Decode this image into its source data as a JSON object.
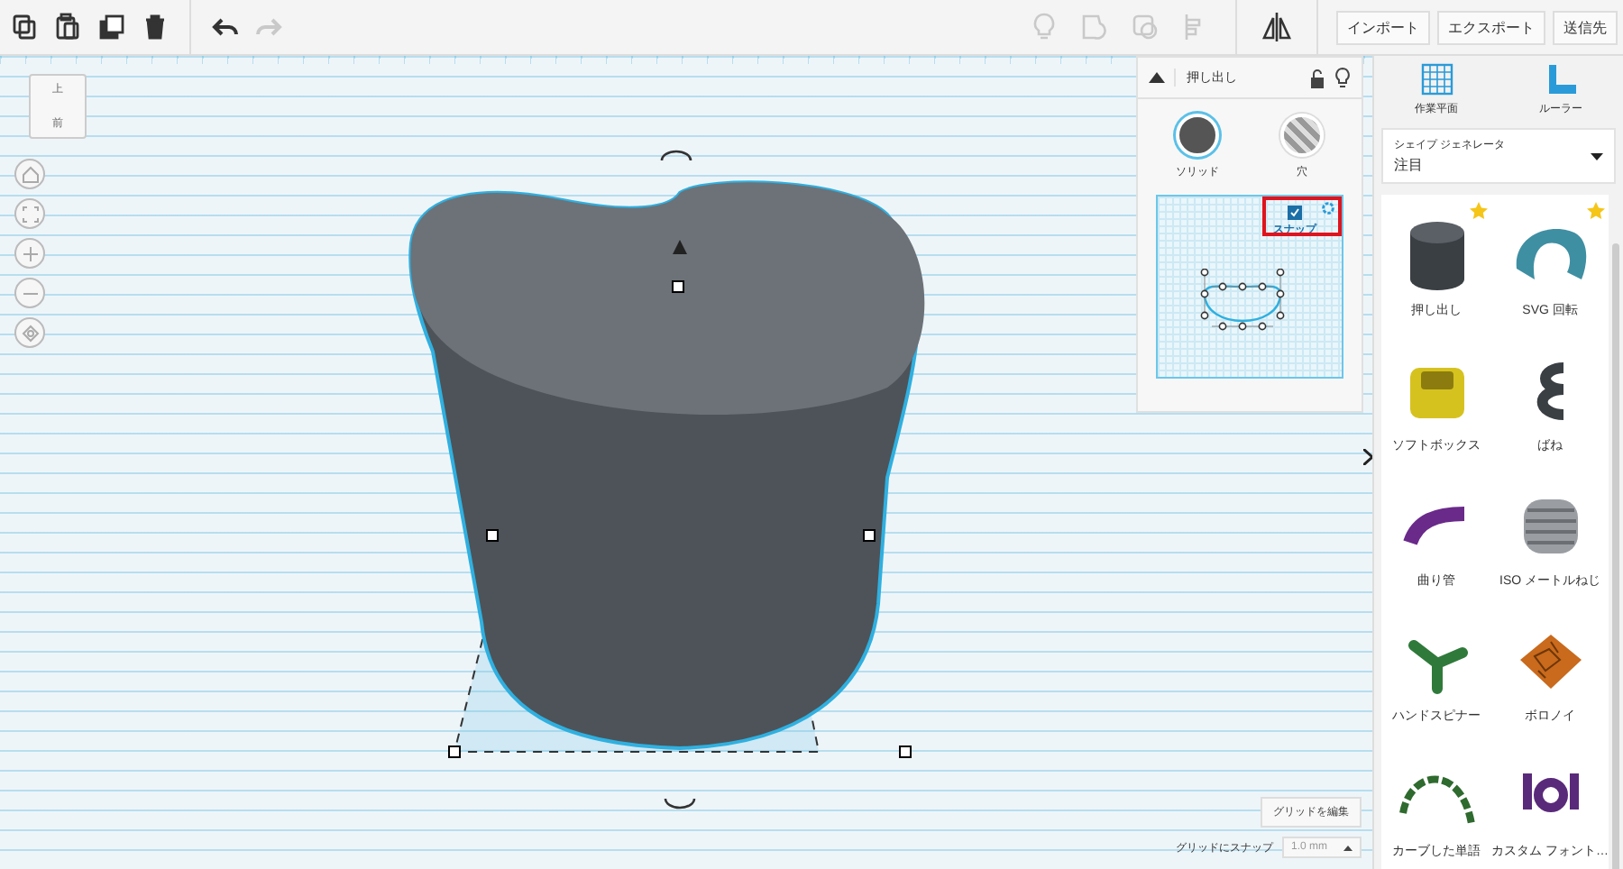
{
  "toolbar": {
    "actions": [
      {
        "kind": "copy",
        "disabled": false
      },
      {
        "kind": "paste",
        "disabled": false
      },
      {
        "kind": "duplicate",
        "disabled": false
      },
      {
        "kind": "delete",
        "disabled": false
      },
      {
        "kind": "undo",
        "disabled": false
      },
      {
        "kind": "redo",
        "disabled": true
      }
    ],
    "view_tools": [
      {
        "kind": "light",
        "disabled": true
      },
      {
        "kind": "group",
        "disabled": true
      },
      {
        "kind": "ungroup",
        "disabled": true
      },
      {
        "kind": "align",
        "disabled": true
      },
      {
        "kind": "mirror",
        "disabled": false
      }
    ],
    "buttons": [
      "インポート",
      "エクスポート",
      "送信先"
    ]
  },
  "view_cube": {
    "top": "上",
    "front": "前"
  },
  "inspector": {
    "title": "押し出し",
    "modes": [
      {
        "kind": "solid",
        "label": "ソリッド",
        "selected": true
      },
      {
        "kind": "hole",
        "label": "穴",
        "selected": false
      }
    ],
    "snap": {
      "label": "スナップ",
      "checked": true
    }
  },
  "grid_controls": {
    "edit_button": "グリッドを編集",
    "snap_label": "グリッドにスナップ",
    "snap_value": "1.0 mm"
  },
  "side_panel": {
    "tools": [
      {
        "kind": "workplane",
        "label": "作業平面"
      },
      {
        "kind": "ruler",
        "label": "ルーラー"
      }
    ],
    "dropdown": {
      "label": "シェイプ ジェネレータ",
      "value": "注目"
    },
    "shapes": [
      {
        "kind": "cylinder",
        "label": "押し出し",
        "starred": true
      },
      {
        "kind": "ring",
        "label": "SVG 回転",
        "starred": true
      },
      {
        "kind": "box",
        "label": "ソフトボックス",
        "starred": false
      },
      {
        "kind": "spring",
        "label": "ばね",
        "starred": false
      },
      {
        "kind": "pipe",
        "label": "曲り管",
        "starred": false
      },
      {
        "kind": "screw",
        "label": "ISO メートルねじ",
        "starred": false
      },
      {
        "kind": "spinner",
        "label": "ハンドスピナー",
        "starred": false
      },
      {
        "kind": "voronoi",
        "label": "ボロノイ",
        "starred": false
      },
      {
        "kind": "curved",
        "label": "カーブした単語",
        "starred": false
      },
      {
        "kind": "font",
        "label": "カスタム フォント…",
        "starred": false
      }
    ]
  }
}
